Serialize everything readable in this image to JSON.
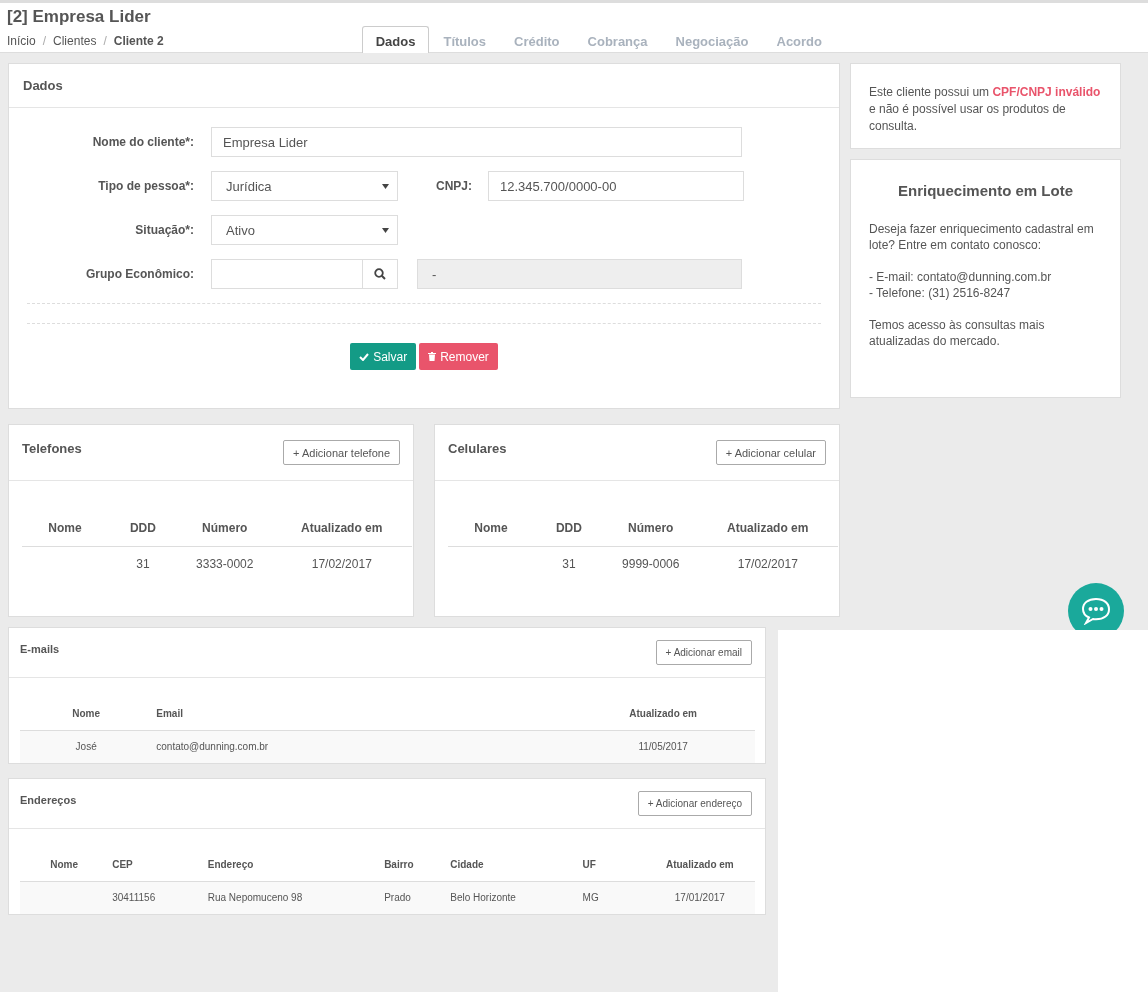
{
  "header": {
    "title": "[2] Empresa Lider",
    "breadcrumbs": [
      {
        "label": "Início",
        "current": false
      },
      {
        "separator": "/",
        "label": "Clientes",
        "current": false
      },
      {
        "separator": "/",
        "label": "Cliente 2",
        "current": true
      }
    ],
    "tabs": [
      {
        "label": "Dados",
        "selected": true
      },
      {
        "label": "Títulos",
        "selected": false
      },
      {
        "label": "Crédito",
        "selected": false
      },
      {
        "label": "Cobrança",
        "selected": false
      },
      {
        "label": "Negociação",
        "selected": false
      },
      {
        "label": "Acordo",
        "selected": false
      }
    ]
  },
  "dados": {
    "title": "Dados",
    "rows": [
      {
        "label": "Nome do cliente*:",
        "kind": "text",
        "value": "Empresa Lider"
      },
      {
        "label": "Tipo de pessoa*:",
        "kind": "select",
        "value": "Jurídica",
        "extra": {
          "label": "CNPJ:",
          "kind": "text",
          "value": "12.345.700/0000-00"
        }
      },
      {
        "label": "Situação*:",
        "kind": "select",
        "value": "Ativo"
      },
      {
        "label": "Grupo Econômico:",
        "kind": "search",
        "value": "",
        "extra": {
          "kind": "readonly",
          "value": "-"
        }
      }
    ],
    "buttons": [
      {
        "label": "Salvar",
        "kind": "save"
      },
      {
        "label": "Remover",
        "kind": "remove"
      }
    ]
  },
  "notice": "Este cliente possui um **CPF/CNPJ inválido** e não é possível usar os produtos de consulta.",
  "enrichment": {
    "title": "Enriquecimento em Lote",
    "paragraphs": [
      [
        "Deseja fazer enriquecimento cadastral em lote? Entre em contato conosco:"
      ],
      [
        "- E-mail: contato@dunning.com.br",
        "- Telefone: (31) 2516-8247"
      ],
      [
        "Temos acesso às consultas mais atualizadas do mercado."
      ]
    ]
  },
  "contacts": [
    {
      "title": "Telefones",
      "add_button": "+ Adicionar telefone",
      "columns": [
        "Nome",
        "DDD",
        "Número",
        "Atualizado em"
      ],
      "rows": [
        [
          "",
          "31",
          "3333-0002",
          "17/02/2017"
        ]
      ]
    },
    {
      "title": "Celulares",
      "add_button": "+ Adicionar celular",
      "columns": [
        "Nome",
        "DDD",
        "Número",
        "Atualizado em"
      ],
      "rows": [
        [
          "",
          "31",
          "9999-0006",
          "17/02/2017"
        ]
      ]
    }
  ],
  "lists": [
    {
      "title": "E-mails",
      "add_button": "+ Adicionar email",
      "columns": [
        "Nome",
        "Email",
        "Atualizado em"
      ],
      "rows": [
        [
          "José",
          "contato@dunning.com.br",
          "11/05/2017"
        ]
      ]
    },
    {
      "title": "Endereços",
      "add_button": "+ Adicionar endereço",
      "columns": [
        "Nome",
        "CEP",
        "Endereço",
        "Bairro",
        "Cidade",
        "UF",
        "Atualizado em"
      ],
      "rows": [
        [
          "",
          "30411156",
          "Rua Nepomuceno 98",
          "Prado",
          "Belo Horizonte",
          "MG",
          "17/01/2017"
        ]
      ]
    }
  ]
}
